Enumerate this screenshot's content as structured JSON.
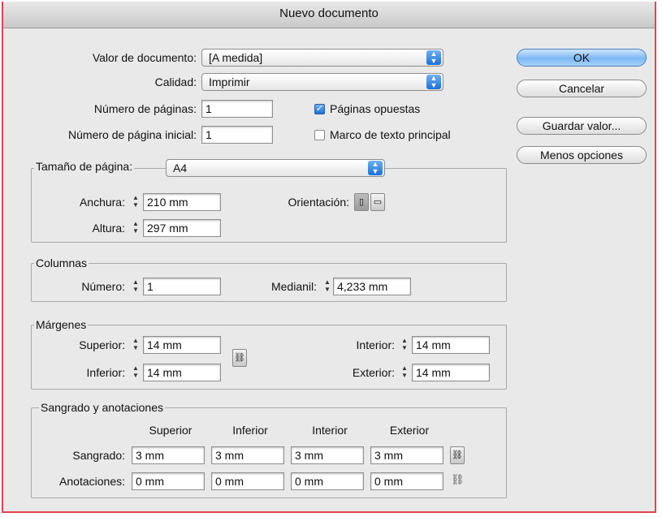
{
  "window": {
    "title": "Nuevo documento"
  },
  "doc": {
    "preset_label": "Valor de documento:",
    "preset_value": "[A medida]",
    "intent_label": "Calidad:",
    "intent_value": "Imprimir",
    "pages_label": "Número de páginas:",
    "pages_value": "1",
    "start_label": "Número de página inicial:",
    "start_value": "1",
    "facing_label": "Páginas opuestas",
    "facing_checked": true,
    "master_label": "Marco de texto principal",
    "master_checked": false
  },
  "buttons": {
    "ok": "OK",
    "cancel": "Cancelar",
    "save_preset": "Guardar valor...",
    "fewer_options": "Menos opciones"
  },
  "page_size": {
    "title": "Tamaño de página:",
    "value": "A4",
    "width_label": "Anchura:",
    "width_value": "210 mm",
    "height_label": "Altura:",
    "height_value": "297 mm",
    "orientation_label": "Orientación:"
  },
  "columns": {
    "title": "Columnas",
    "number_label": "Número:",
    "number_value": "1",
    "gutter_label": "Medianil:",
    "gutter_value": "4,233 mm"
  },
  "margins": {
    "title": "Márgenes",
    "top_label": "Superior:",
    "top_value": "14 mm",
    "bottom_label": "Inferior:",
    "bottom_value": "14 mm",
    "inside_label": "Interior:",
    "inside_value": "14 mm",
    "outside_label": "Exterior:",
    "outside_value": "14 mm"
  },
  "bleed": {
    "title": "Sangrado y anotaciones",
    "headers": [
      "Superior",
      "Inferior",
      "Interior",
      "Exterior"
    ],
    "bleed_label": "Sangrado:",
    "bleed_values": [
      "3 mm",
      "3 mm",
      "3 mm",
      "3 mm"
    ],
    "slug_label": "Anotaciones:",
    "slug_values": [
      "0 mm",
      "0 mm",
      "0 mm",
      "0 mm"
    ]
  }
}
